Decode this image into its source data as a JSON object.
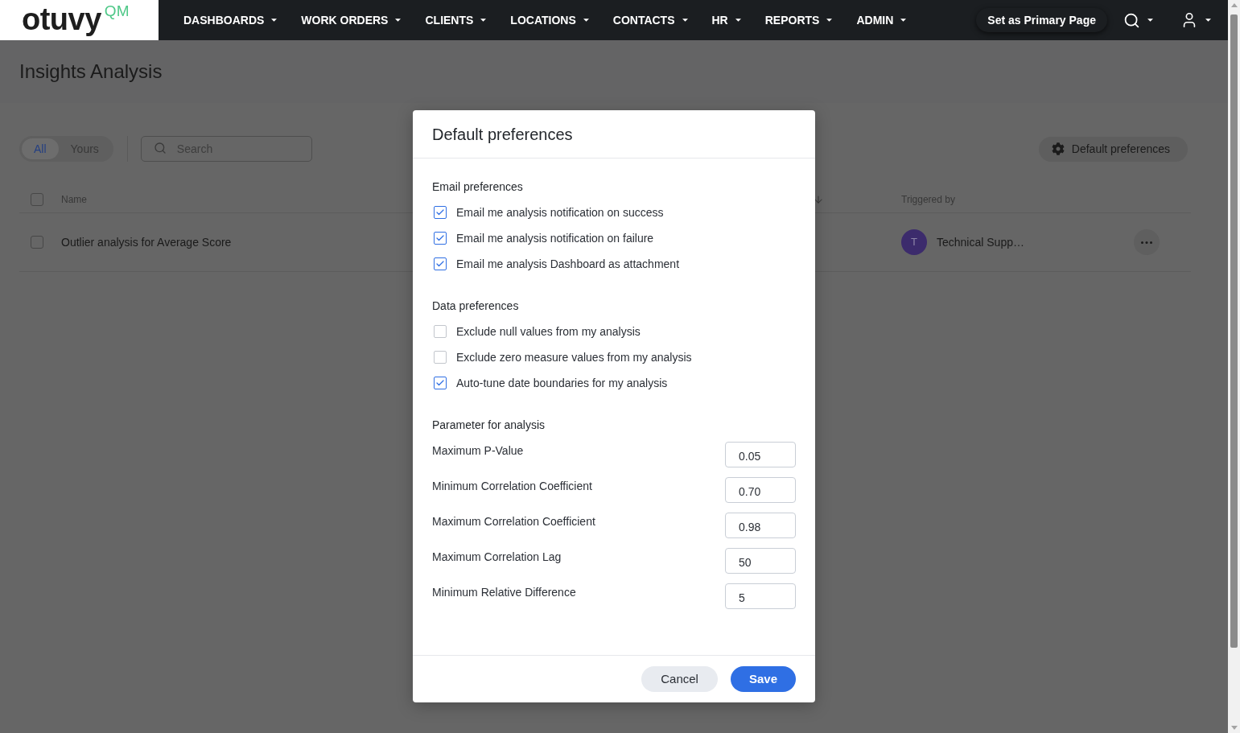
{
  "navbar": {
    "logo": {
      "wordmark": "otuvy",
      "suffix": "QM"
    },
    "menu": [
      "DASHBOARDS",
      "WORK ORDERS",
      "CLIENTS",
      "LOCATIONS",
      "CONTACTS",
      "HR",
      "REPORTS",
      "ADMIN"
    ],
    "primary_page_button": "Set as Primary Page"
  },
  "page": {
    "title": "Insights Analysis",
    "filter_tabs": [
      {
        "label": "All",
        "selected": true
      },
      {
        "label": "Yours",
        "selected": false
      }
    ],
    "search": {
      "placeholder": "Search"
    },
    "preferences_button": "Default preferences",
    "table": {
      "select_all_checked": false,
      "columns": [
        {
          "label": "Name"
        },
        {
          "label": "Triggered by"
        }
      ],
      "rows": [
        {
          "checked": false,
          "name": "Outlier analysis for Average Score",
          "triggered_by": {
            "initial": "T",
            "name": "Technical Supp…"
          }
        }
      ]
    }
  },
  "dialog": {
    "title": "Default preferences",
    "sections": [
      {
        "heading": "Email preferences",
        "options": [
          {
            "label": "Email me analysis notification on success",
            "checked": true
          },
          {
            "label": "Email me analysis notification on failure",
            "checked": true
          },
          {
            "label": "Email me analysis Dashboard as attachment",
            "checked": true
          }
        ]
      },
      {
        "heading": "Data preferences",
        "options": [
          {
            "label": "Exclude null values from my analysis",
            "checked": false
          },
          {
            "label": "Exclude zero measure values from my analysis",
            "checked": false
          },
          {
            "label": "Auto-tune date boundaries for my analysis",
            "checked": true
          }
        ]
      }
    ],
    "parameters": {
      "heading": "Parameter for analysis",
      "fields": [
        {
          "label": "Maximum P-Value",
          "value": "0.05"
        },
        {
          "label": "Minimum Correlation Coefficient",
          "value": "0.70"
        },
        {
          "label": "Maximum Correlation Coefficient",
          "value": "0.98"
        },
        {
          "label": "Maximum Correlation Lag",
          "value": "50"
        },
        {
          "label": "Minimum Relative Difference",
          "value": "5"
        }
      ]
    },
    "buttons": [
      {
        "label": "Cancel",
        "kind": "secondary"
      },
      {
        "label": "Save",
        "kind": "primary"
      }
    ]
  }
}
